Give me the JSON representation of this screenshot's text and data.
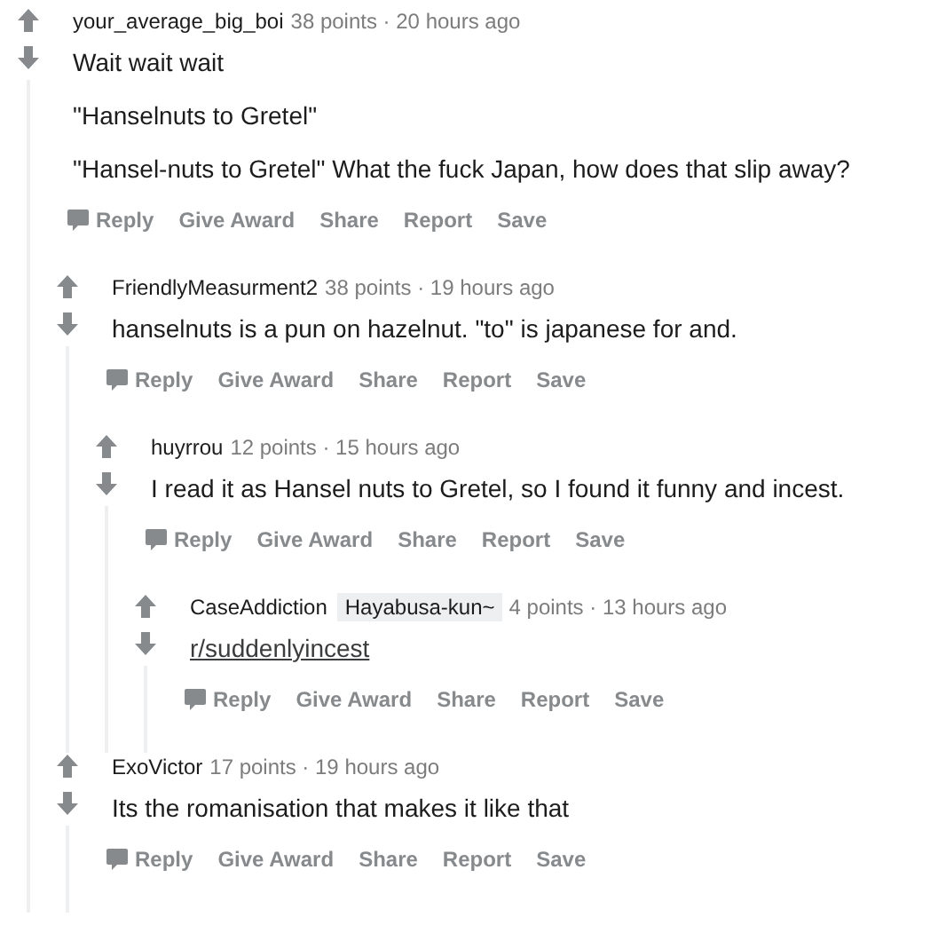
{
  "comments": [
    {
      "author": "your_average_big_boi",
      "meta": "38 points · 20 hours ago",
      "body": [
        {
          "kind": "text",
          "text": "Wait wait wait"
        },
        {
          "kind": "text",
          "text": "\"Hanselnuts to Gretel\""
        },
        {
          "kind": "text",
          "text": "\"Hansel-nuts to Gretel\" What the fuck Japan, how does that slip away?"
        }
      ],
      "actions": [
        "Reply",
        "Give Award",
        "Share",
        "Report",
        "Save"
      ],
      "children": [
        {
          "author": "FriendlyMeasurment2",
          "meta": "38 points · 19 hours ago",
          "body": [
            {
              "kind": "text",
              "text": "hanselnuts is a pun on hazelnut. \"to\" is japanese for and."
            }
          ],
          "actions": [
            "Reply",
            "Give Award",
            "Share",
            "Report",
            "Save"
          ],
          "children": [
            {
              "author": "huyrrou",
              "meta": "12 points · 15 hours ago",
              "body": [
                {
                  "kind": "text",
                  "text": "I read it as Hansel nuts to Gretel, so I found it funny and incest."
                }
              ],
              "actions": [
                "Reply",
                "Give Award",
                "Share",
                "Report",
                "Save"
              ],
              "children": [
                {
                  "author": "CaseAddiction",
                  "flair": "Hayabusa-kun~",
                  "meta": "4 points · 13 hours ago",
                  "body": [
                    {
                      "kind": "link",
                      "text": "r/suddenlyincest"
                    }
                  ],
                  "actions": [
                    "Reply",
                    "Give Award",
                    "Share",
                    "Report",
                    "Save"
                  ]
                }
              ]
            }
          ]
        },
        {
          "author": "ExoVictor",
          "meta": "17 points · 19 hours ago",
          "body": [
            {
              "kind": "text",
              "text": "Its the romanisation that makes it like that"
            }
          ],
          "actions": [
            "Reply",
            "Give Award",
            "Share",
            "Report",
            "Save"
          ]
        }
      ]
    }
  ]
}
